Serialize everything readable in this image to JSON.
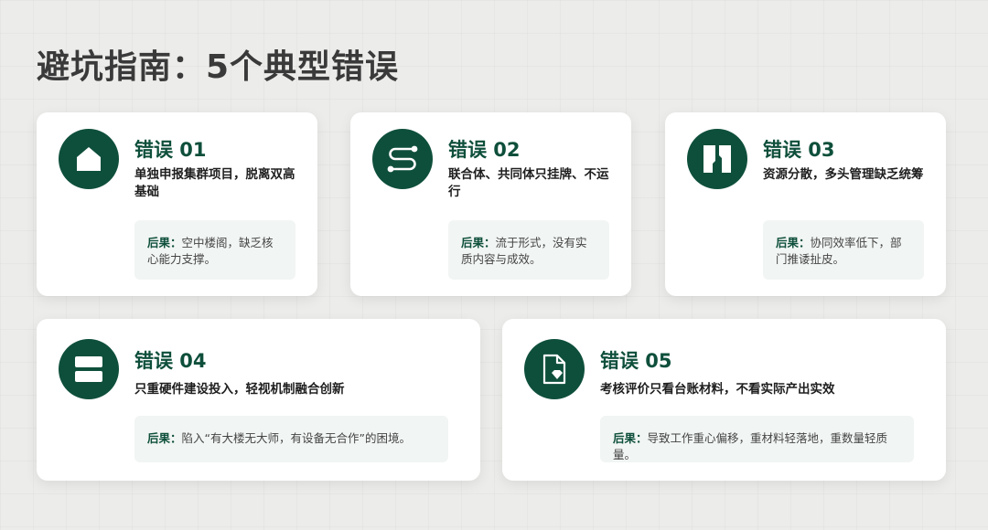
{
  "title": "避坑指南：5个典型错误",
  "colors": {
    "accent": "#0e4f3b",
    "result_bg": "#f1f5f3"
  },
  "cards": [
    {
      "icon": "house-icon",
      "title": "错误 01",
      "desc": "单独申报集群项目，脱离双高基础",
      "result_label": "后果：",
      "result_text": "空中楼阁，缺乏核心能力支撑。"
    },
    {
      "icon": "path-icon",
      "title": "错误 02",
      "desc": "联合体、共同体只挂牌、不运行",
      "result_label": "后果：",
      "result_text": "流于形式，没有实质内容与成效。"
    },
    {
      "icon": "split-icon",
      "title": "错误 03",
      "desc": "资源分散，多头管理缺乏统筹",
      "result_label": "后果：",
      "result_text": "协同效率低下，部门推诿扯皮。"
    },
    {
      "icon": "layers-icon",
      "title": "错误 04",
      "desc": "只重硬件建设投入，轻视机制融合创新",
      "result_label": "后果：",
      "result_text": "陷入“有大楼无大师，有设备无合作”的困境。"
    },
    {
      "icon": "document-icon",
      "title": "错误 05",
      "desc": "考核评价只看台账材料，不看实际产出实效",
      "result_label": "后果：",
      "result_text": "导致工作重心偏移，重材料轻落地，重数量轻质量。"
    }
  ]
}
